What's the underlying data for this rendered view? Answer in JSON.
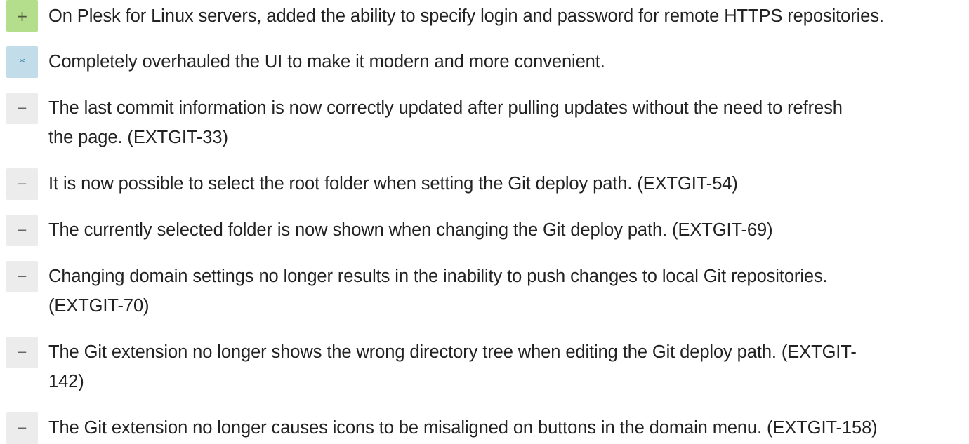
{
  "entries": [
    {
      "type": "added",
      "symbol": "+",
      "text": "On Plesk for Linux servers, added the ability to specify login and password for remote HTTPS repositories."
    },
    {
      "type": "changed",
      "symbol": "*",
      "text": "Completely overhauled the UI to make it modern and more convenient."
    },
    {
      "type": "fixed",
      "symbol": "−",
      "line1": "The last commit information is now correctly updated after pulling updates without the need to refresh",
      "line2": "the page. (EXTGIT-33)"
    },
    {
      "type": "fixed",
      "symbol": "−",
      "text": "It is now possible to select the root folder when setting the Git deploy path. (EXTGIT-54)"
    },
    {
      "type": "fixed",
      "symbol": "−",
      "text": "The currently selected folder is now shown when changing the Git deploy path. (EXTGIT-69)"
    },
    {
      "type": "fixed",
      "symbol": "−",
      "line1": "Changing domain settings no longer results in the inability to push changes to local Git repositories.",
      "line2": "(EXTGIT-70)"
    },
    {
      "type": "fixed",
      "symbol": "−",
      "line1": "The Git extension no longer shows the wrong directory tree when editing the Git deploy path. (EXTGIT-",
      "line2": "142)"
    },
    {
      "type": "fixed",
      "symbol": "−",
      "text": "The Git extension no longer causes icons to be misaligned on buttons in the domain menu. (EXTGIT-158)"
    }
  ]
}
